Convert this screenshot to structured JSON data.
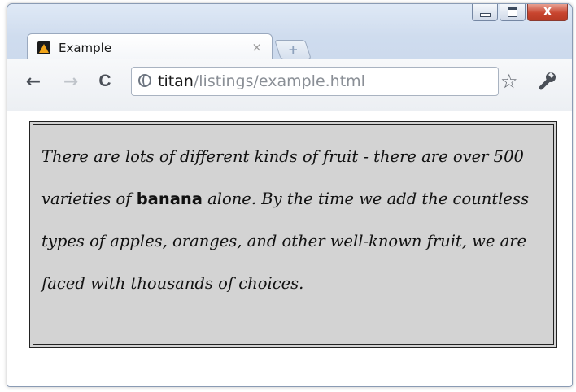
{
  "browser": {
    "tab": {
      "title": "Example",
      "close_glyph": "×",
      "favicon": "warning-favicon-icon"
    },
    "new_tab_glyph": "+",
    "window_controls": {
      "close_glyph": "X"
    },
    "toolbar": {
      "back_glyph": "←",
      "forward_glyph": "→",
      "reload_glyph": "C",
      "url_host": "titan",
      "url_path": "/listings/example.html",
      "star_glyph": "☆"
    }
  },
  "content": {
    "text_before": "There are lots of different kinds of fruit - there are over 500 varieties of ",
    "bold_word": "banana",
    "text_after": " alone. By the time we add the countless types of apples, oranges, and other well-known fruit, we are faced with thousands of choices."
  },
  "colors": {
    "paragraph_background": "#d3d3d3",
    "close_button": "#c8452f"
  }
}
